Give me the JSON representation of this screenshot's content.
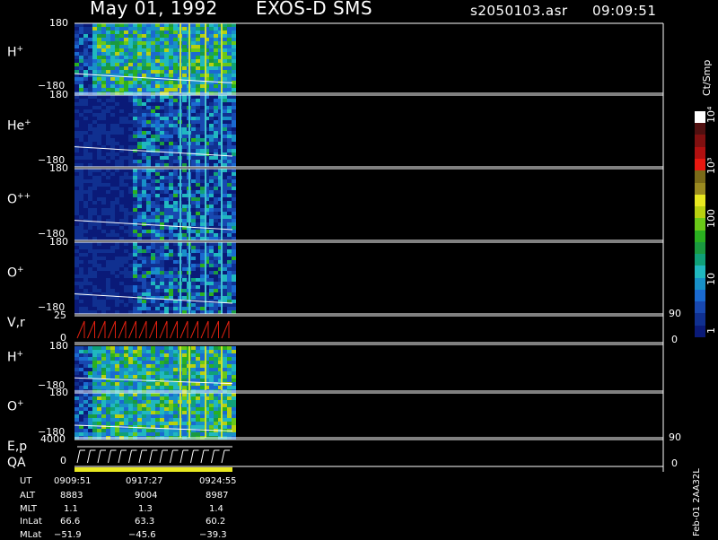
{
  "header": {
    "date": "May 01, 1992",
    "mission": "EXOS-D SMS",
    "file": "s2050103.asr",
    "time": "09:09:51"
  },
  "panels": [
    {
      "label": "H",
      "sup": "+",
      "top": "180",
      "bottom": "−180"
    },
    {
      "label": "He",
      "sup": "+",
      "top": "180",
      "bottom": "−180"
    },
    {
      "label": "O",
      "sup": "++",
      "top": "180",
      "bottom": "−180"
    },
    {
      "label": "O",
      "sup": "+",
      "top": "180",
      "bottom": "−180"
    },
    {
      "label": "V,r",
      "sup": "",
      "top": "25",
      "bottom": "0",
      "right_top": "90",
      "right_bottom": "0"
    },
    {
      "label": "H",
      "sup": "+",
      "top": "180",
      "bottom": "−180"
    },
    {
      "label": "O",
      "sup": "+",
      "top": "180",
      "bottom": "−180"
    },
    {
      "label": "E,p",
      "sup": "",
      "label2": "QA",
      "top": "4000",
      "bottom": "0",
      "right_top": "90",
      "right_bottom": "0"
    }
  ],
  "colorbar": {
    "unit": "Ct/Smp",
    "ticks": [
      "1",
      "10",
      "100",
      "10³",
      "10⁴"
    ],
    "colors": [
      "#0a1a78",
      "#103090",
      "#1848b0",
      "#1a6ad0",
      "#1890c8",
      "#20b8c0",
      "#10a078",
      "#1a9a40",
      "#2ab020",
      "#6ac818",
      "#b8d010",
      "#e8e820",
      "#9a8a20",
      "#7a6a18",
      "#e81810",
      "#b01010",
      "#801010",
      "#501010",
      "#ffffff"
    ]
  },
  "footer": {
    "rows": [
      {
        "name": "UT",
        "v": [
          "0909:51",
          "0917:27",
          "0924:55"
        ]
      },
      {
        "name": "ALT",
        "v": [
          "8883",
          "9004",
          "8987"
        ]
      },
      {
        "name": "MLT",
        "v": [
          "1.1",
          "1.3",
          "1.4"
        ]
      },
      {
        "name": "InLat",
        "v": [
          "66.6",
          "63.3",
          "60.2"
        ]
      },
      {
        "name": "MLat",
        "v": [
          "−51.9",
          "−45.6",
          "−39.3"
        ]
      }
    ],
    "stamp": "Feb-01 2AA32L"
  }
}
